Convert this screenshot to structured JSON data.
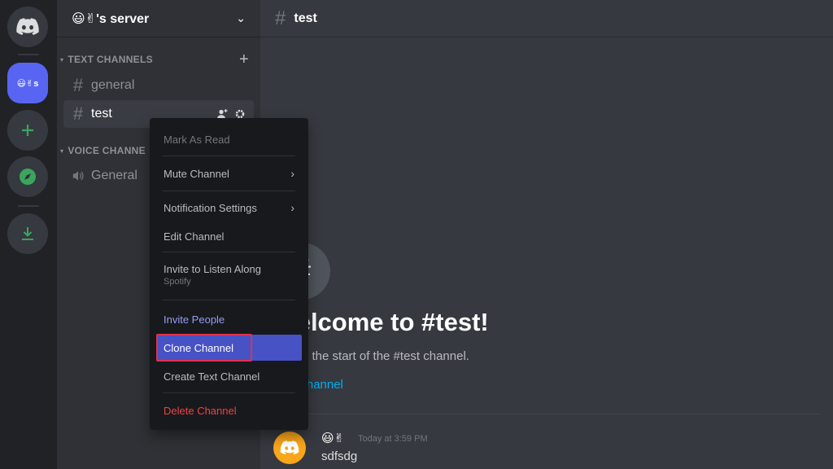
{
  "rail": {
    "home_icon": "discord-logo-icon",
    "server_label": "😃✌s",
    "add_icon": "plus-icon",
    "explore_icon": "compass-icon",
    "download_icon": "download-icon"
  },
  "server": {
    "name": "😃✌'s server",
    "dropdown_icon": "chevron-down-icon"
  },
  "categories": {
    "text": "TEXT CHANNELS",
    "voice": "VOICE CHANNE"
  },
  "channels": {
    "text": [
      {
        "name": "general",
        "active": false
      },
      {
        "name": "test",
        "active": true
      }
    ],
    "voice": [
      {
        "name": "General"
      }
    ]
  },
  "chat": {
    "channel_name": "test",
    "welcome_title": "Welcome to #test!",
    "welcome_subtitle": "This is the start of the #test channel.",
    "edit_link": "Edit Channel",
    "message": {
      "author": "😃✌",
      "timestamp": "Today at 3:59 PM",
      "text": "sdfsdg"
    }
  },
  "context_menu": {
    "items": [
      {
        "label": "Mark As Read",
        "state": "disabled"
      },
      {
        "label": "Mute Channel",
        "submenu": true
      },
      {
        "label": "Notification Settings",
        "submenu": true
      },
      {
        "label": "Edit Channel"
      },
      {
        "label": "Invite to Listen Along",
        "sublabel": "Spotify"
      },
      {
        "label": "Invite People",
        "style": "accent"
      },
      {
        "label": "Clone Channel",
        "state": "highlighted"
      },
      {
        "label": "Create Text Channel"
      },
      {
        "label": "Delete Channel",
        "style": "danger"
      }
    ]
  },
  "colors": {
    "accent": "#5865f2",
    "highlight": "#e0314d",
    "link": "#00aff4",
    "danger": "#ed4245",
    "online": "#3ba55d"
  }
}
